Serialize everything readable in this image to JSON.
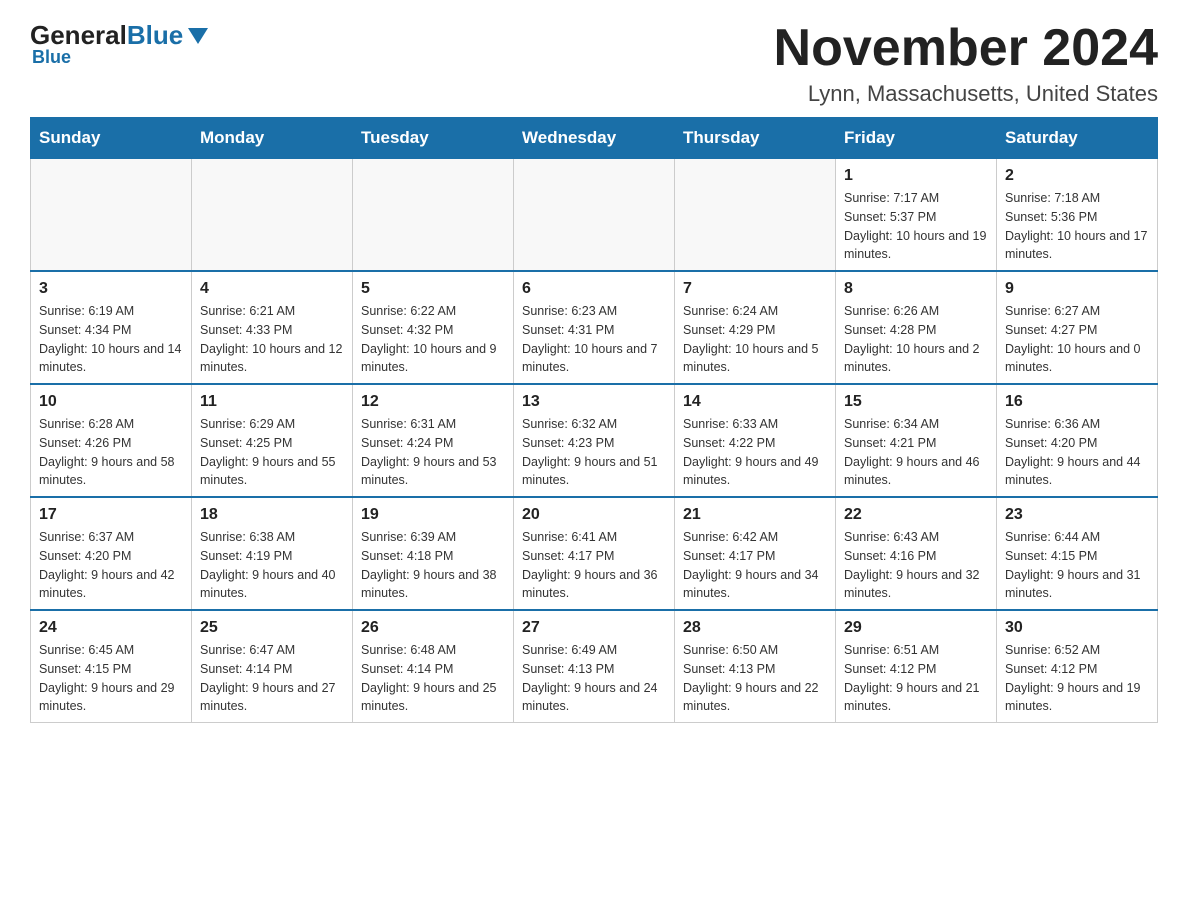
{
  "logo": {
    "general": "General",
    "blue": "Blue",
    "underline": "Blue"
  },
  "header": {
    "title": "November 2024",
    "subtitle": "Lynn, Massachusetts, United States"
  },
  "days_of_week": [
    "Sunday",
    "Monday",
    "Tuesday",
    "Wednesday",
    "Thursday",
    "Friday",
    "Saturday"
  ],
  "weeks": [
    [
      {
        "day": "",
        "info": ""
      },
      {
        "day": "",
        "info": ""
      },
      {
        "day": "",
        "info": ""
      },
      {
        "day": "",
        "info": ""
      },
      {
        "day": "",
        "info": ""
      },
      {
        "day": "1",
        "info": "Sunrise: 7:17 AM\nSunset: 5:37 PM\nDaylight: 10 hours and 19 minutes."
      },
      {
        "day": "2",
        "info": "Sunrise: 7:18 AM\nSunset: 5:36 PM\nDaylight: 10 hours and 17 minutes."
      }
    ],
    [
      {
        "day": "3",
        "info": "Sunrise: 6:19 AM\nSunset: 4:34 PM\nDaylight: 10 hours and 14 minutes."
      },
      {
        "day": "4",
        "info": "Sunrise: 6:21 AM\nSunset: 4:33 PM\nDaylight: 10 hours and 12 minutes."
      },
      {
        "day": "5",
        "info": "Sunrise: 6:22 AM\nSunset: 4:32 PM\nDaylight: 10 hours and 9 minutes."
      },
      {
        "day": "6",
        "info": "Sunrise: 6:23 AM\nSunset: 4:31 PM\nDaylight: 10 hours and 7 minutes."
      },
      {
        "day": "7",
        "info": "Sunrise: 6:24 AM\nSunset: 4:29 PM\nDaylight: 10 hours and 5 minutes."
      },
      {
        "day": "8",
        "info": "Sunrise: 6:26 AM\nSunset: 4:28 PM\nDaylight: 10 hours and 2 minutes."
      },
      {
        "day": "9",
        "info": "Sunrise: 6:27 AM\nSunset: 4:27 PM\nDaylight: 10 hours and 0 minutes."
      }
    ],
    [
      {
        "day": "10",
        "info": "Sunrise: 6:28 AM\nSunset: 4:26 PM\nDaylight: 9 hours and 58 minutes."
      },
      {
        "day": "11",
        "info": "Sunrise: 6:29 AM\nSunset: 4:25 PM\nDaylight: 9 hours and 55 minutes."
      },
      {
        "day": "12",
        "info": "Sunrise: 6:31 AM\nSunset: 4:24 PM\nDaylight: 9 hours and 53 minutes."
      },
      {
        "day": "13",
        "info": "Sunrise: 6:32 AM\nSunset: 4:23 PM\nDaylight: 9 hours and 51 minutes."
      },
      {
        "day": "14",
        "info": "Sunrise: 6:33 AM\nSunset: 4:22 PM\nDaylight: 9 hours and 49 minutes."
      },
      {
        "day": "15",
        "info": "Sunrise: 6:34 AM\nSunset: 4:21 PM\nDaylight: 9 hours and 46 minutes."
      },
      {
        "day": "16",
        "info": "Sunrise: 6:36 AM\nSunset: 4:20 PM\nDaylight: 9 hours and 44 minutes."
      }
    ],
    [
      {
        "day": "17",
        "info": "Sunrise: 6:37 AM\nSunset: 4:20 PM\nDaylight: 9 hours and 42 minutes."
      },
      {
        "day": "18",
        "info": "Sunrise: 6:38 AM\nSunset: 4:19 PM\nDaylight: 9 hours and 40 minutes."
      },
      {
        "day": "19",
        "info": "Sunrise: 6:39 AM\nSunset: 4:18 PM\nDaylight: 9 hours and 38 minutes."
      },
      {
        "day": "20",
        "info": "Sunrise: 6:41 AM\nSunset: 4:17 PM\nDaylight: 9 hours and 36 minutes."
      },
      {
        "day": "21",
        "info": "Sunrise: 6:42 AM\nSunset: 4:17 PM\nDaylight: 9 hours and 34 minutes."
      },
      {
        "day": "22",
        "info": "Sunrise: 6:43 AM\nSunset: 4:16 PM\nDaylight: 9 hours and 32 minutes."
      },
      {
        "day": "23",
        "info": "Sunrise: 6:44 AM\nSunset: 4:15 PM\nDaylight: 9 hours and 31 minutes."
      }
    ],
    [
      {
        "day": "24",
        "info": "Sunrise: 6:45 AM\nSunset: 4:15 PM\nDaylight: 9 hours and 29 minutes."
      },
      {
        "day": "25",
        "info": "Sunrise: 6:47 AM\nSunset: 4:14 PM\nDaylight: 9 hours and 27 minutes."
      },
      {
        "day": "26",
        "info": "Sunrise: 6:48 AM\nSunset: 4:14 PM\nDaylight: 9 hours and 25 minutes."
      },
      {
        "day": "27",
        "info": "Sunrise: 6:49 AM\nSunset: 4:13 PM\nDaylight: 9 hours and 24 minutes."
      },
      {
        "day": "28",
        "info": "Sunrise: 6:50 AM\nSunset: 4:13 PM\nDaylight: 9 hours and 22 minutes."
      },
      {
        "day": "29",
        "info": "Sunrise: 6:51 AM\nSunset: 4:12 PM\nDaylight: 9 hours and 21 minutes."
      },
      {
        "day": "30",
        "info": "Sunrise: 6:52 AM\nSunset: 4:12 PM\nDaylight: 9 hours and 19 minutes."
      }
    ]
  ]
}
